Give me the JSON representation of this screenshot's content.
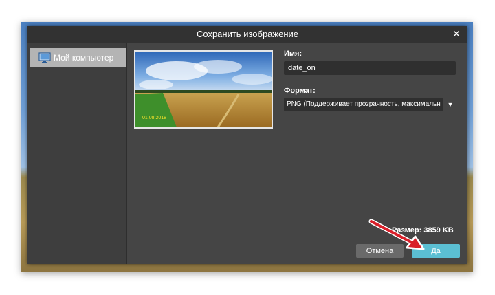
{
  "dialog": {
    "title": "Сохранить изображение",
    "close_symbol": "✕"
  },
  "sidebar": {
    "items": [
      {
        "label": "Мой компьютер",
        "icon": "monitor-icon",
        "selected": true
      }
    ]
  },
  "preview": {
    "date_stamp": "01.08.2018"
  },
  "form": {
    "name_label": "Имя:",
    "name_value": "date_on",
    "format_label": "Формат:",
    "format_value": "PNG (Поддерживает прозрачность, максимальн",
    "format_arrow": "▼"
  },
  "footer": {
    "size_text": "Размер: 3859 KB",
    "cancel_label": "Отмена",
    "ok_label": "Да"
  },
  "colors": {
    "dialog_bg": "#454545",
    "titlebar_bg": "#323232",
    "accent": "#5bbfd3",
    "arrow": "#d9202a"
  }
}
